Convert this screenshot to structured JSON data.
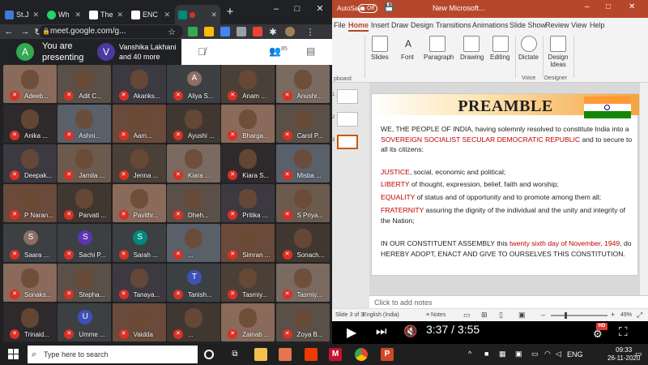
{
  "chrome": {
    "tabs": [
      {
        "label": "St.J",
        "color": "#3e7bd6"
      },
      {
        "label": "Wh",
        "color": "#25d366"
      },
      {
        "label": "The",
        "color": "#ffffff"
      },
      {
        "label": "ENC",
        "color": "#ffffff"
      },
      {
        "label": "",
        "color": "#00897b"
      }
    ],
    "new_tab": "+",
    "window": {
      "minimize": "–",
      "maximize": "□",
      "close": "✕"
    },
    "url": "meet.google.com/g..."
  },
  "meet": {
    "presenter_initial": "A",
    "presenting_text": "You are presenting",
    "speaker_initial": "V",
    "speaker_name": "Vanshika Lakhani",
    "speaker_more": "and 40 more",
    "people_count": "85",
    "participants": [
      [
        "Adeeb...",
        "Adit C...",
        "Akanks...",
        "Aliya S...",
        "Anam ...",
        "Anushr..."
      ],
      [
        "Anika ...",
        "Ashni...",
        "Aam...",
        "Ayushi ...",
        "Bharga...",
        "Carol P..."
      ],
      [
        "Deepak...",
        "Jamila ...",
        "Jenna ...",
        "Kiara ...",
        "Kiara S...",
        "Misba ..."
      ],
      [
        "P Naran...",
        "Parvati ...",
        "Pavithr...",
        "Dheh...",
        "Pritika ...",
        "S Priya..."
      ],
      [
        "Saara ...",
        "Sachi P...",
        "Sarah ...",
        "...",
        "Simran ...",
        "Sonach..."
      ],
      [
        "Sonaks...",
        "Stepha...",
        "Tanaya...",
        "Tanish...",
        "Tasmiy...",
        "Tasmiy..."
      ],
      [
        "Trinaid...",
        "Umme ...",
        "Vaidda",
        "...",
        "Zainab ...",
        "Zoya B..."
      ]
    ],
    "initials": {
      "Aliya": "A",
      "Saara": "S",
      "Sachi": "S",
      "Sarah": "S",
      "Tanish": "T",
      "Umme": "U"
    }
  },
  "ppt": {
    "autosave_label": "AutoSave",
    "autosave_state": "Off",
    "doc_name": "New Microsoft...",
    "menus": [
      "File",
      "Home",
      "Insert",
      "Draw",
      "Design",
      "Transitions",
      "Animations",
      "Slide Show",
      "Review",
      "View",
      "Help"
    ],
    "active_menu": "Home",
    "ribbon": {
      "clipboard": "pboard",
      "slides": "Slides",
      "font": "Font",
      "paragraph": "Paragraph",
      "drawing": "Drawing",
      "editing": "Editing",
      "dictate": "Dictate",
      "design_ideas": "Design Ideas",
      "voice": "Voice",
      "designer": "Designer"
    },
    "thumb_numbers": [
      "1",
      "2",
      "3"
    ],
    "slide": {
      "title": "PREAMBLE",
      "p1_a": "WE, THE PEOPLE OF INDIA, having solemnly resolved to constitute India into a ",
      "p1_b": "SOVEREIGN SOCIALIST SECULAR DEMOCRATIC REPUBLIC",
      "p1_c": " and to secure to all its citizens:",
      "justice": "JUSTICE",
      "justice_rest": ", social, economic and political;",
      "liberty": "LIBERTY",
      "liberty_rest": " of thought, expression, belief, faith and worship;",
      "equality": "EQUALITY",
      "equality_rest": " of status and of opportunity and to promote among them all;",
      "fraternity": "FRATERNITY",
      "fraternity_rest": " assuring the dignity of the individual and the unity and integrity of the Nation;",
      "p3_a": "IN OUR CONSTITUENT ASSEMBLY this ",
      "p3_b": "twenty sixth day of November, 1949",
      "p3_c": ", do HEREBY ADOPT, ENACT AND GIVE TO OURSELVES THIS CONSTITUTION."
    },
    "notes_placeholder": "Click to add notes",
    "status_slide": "Slide 3 of 3",
    "status_lang": "English (India)",
    "status_notes": "Notes",
    "zoom": "49%"
  },
  "player": {
    "time": "3:37 / 3:55",
    "hd": "HD"
  },
  "taskbar": {
    "search_placeholder": "Type here to search",
    "lang": "ENG",
    "time": "09:33",
    "date": "26-11-2020"
  }
}
